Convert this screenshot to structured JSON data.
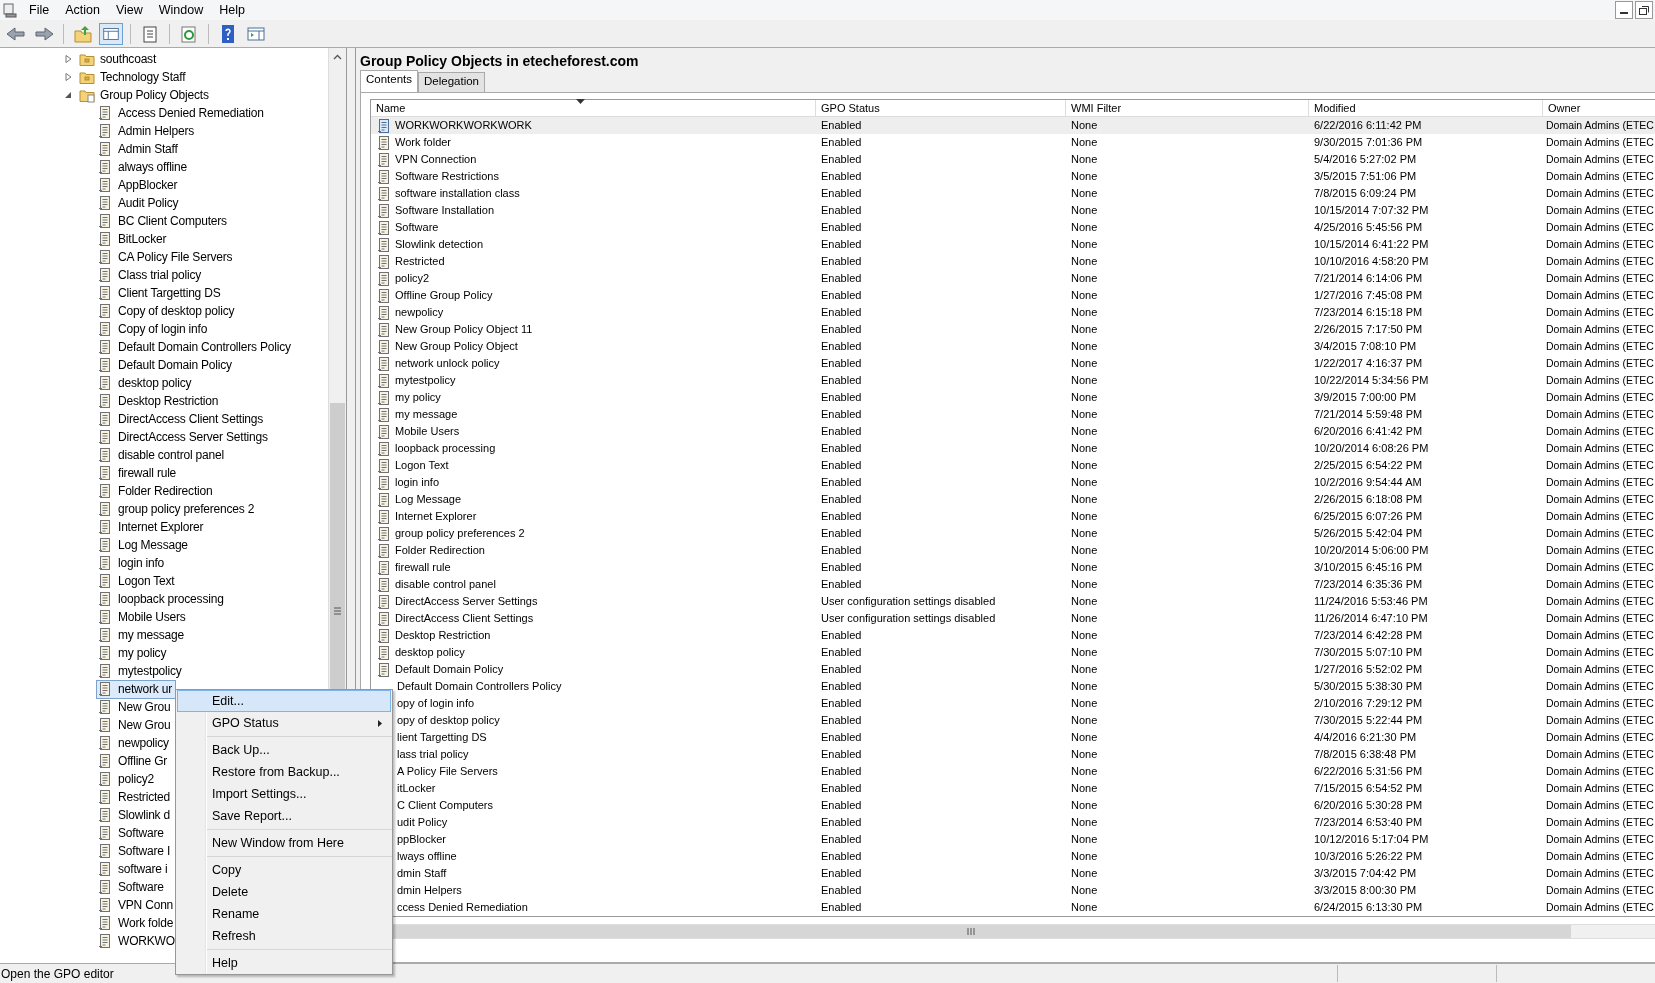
{
  "menu_bar": [
    "File",
    "Action",
    "View",
    "Window",
    "Help"
  ],
  "tree": {
    "items": [
      {
        "label": "southcoast",
        "kind": "folder",
        "expanded": false,
        "selected": false
      },
      {
        "label": "Technology Staff",
        "kind": "folder",
        "expanded": false,
        "selected": false
      },
      {
        "label": "Group Policy Objects",
        "kind": "gpo-folder",
        "expanded": true,
        "selected": false,
        "children": [
          {
            "label": "Access Denied Remediation",
            "selected": false
          },
          {
            "label": "Admin Helpers",
            "selected": false
          },
          {
            "label": "Admin Staff",
            "selected": false
          },
          {
            "label": "always offline",
            "selected": false
          },
          {
            "label": "AppBlocker",
            "selected": false
          },
          {
            "label": "Audit Policy",
            "selected": false
          },
          {
            "label": "BC Client Computers",
            "selected": false
          },
          {
            "label": "BitLocker",
            "selected": false
          },
          {
            "label": "CA Policy File Servers",
            "selected": false
          },
          {
            "label": "Class trial policy",
            "selected": false
          },
          {
            "label": "Client Targetting DS",
            "selected": false
          },
          {
            "label": "Copy of desktop policy",
            "selected": false
          },
          {
            "label": "Copy of login info",
            "selected": false
          },
          {
            "label": "Default Domain Controllers Policy",
            "selected": false
          },
          {
            "label": "Default Domain Policy",
            "selected": false
          },
          {
            "label": "desktop policy",
            "selected": false
          },
          {
            "label": "Desktop Restriction",
            "selected": false
          },
          {
            "label": "DirectAccess Client Settings",
            "selected": false
          },
          {
            "label": "DirectAccess Server Settings",
            "selected": false
          },
          {
            "label": "disable control panel",
            "selected": false
          },
          {
            "label": "firewall rule",
            "selected": false
          },
          {
            "label": "Folder Redirection",
            "selected": false
          },
          {
            "label": "group policy preferences 2",
            "selected": false
          },
          {
            "label": "Internet Explorer",
            "selected": false
          },
          {
            "label": "Log Message",
            "selected": false
          },
          {
            "label": "login info",
            "selected": false
          },
          {
            "label": "Logon Text",
            "selected": false
          },
          {
            "label": "loopback processing",
            "selected": false
          },
          {
            "label": "Mobile Users",
            "selected": false
          },
          {
            "label": "my message",
            "selected": false
          },
          {
            "label": "my policy",
            "selected": false
          },
          {
            "label": "mytestpolicy",
            "selected": false
          },
          {
            "label": "network ur",
            "selected": true
          },
          {
            "label": "New Grou",
            "selected": false
          },
          {
            "label": "New Grou",
            "selected": false
          },
          {
            "label": "newpolicy",
            "selected": false
          },
          {
            "label": "Offline Gr",
            "selected": false
          },
          {
            "label": "policy2",
            "selected": false
          },
          {
            "label": "Restricted",
            "selected": false
          },
          {
            "label": "Slowlink d",
            "selected": false
          },
          {
            "label": "Software",
            "selected": false
          },
          {
            "label": "Software I",
            "selected": false
          },
          {
            "label": "software i",
            "selected": false
          },
          {
            "label": "Software",
            "selected": false
          },
          {
            "label": "VPN Conn",
            "selected": false
          },
          {
            "label": "Work folde",
            "selected": false
          },
          {
            "label": "WORKWO",
            "selected": false
          }
        ]
      }
    ]
  },
  "panel": {
    "title": "Group Policy Objects in etecheforest.com",
    "tabs": [
      {
        "label": "Contents",
        "selected": true
      },
      {
        "label": "Delegation",
        "selected": false
      }
    ],
    "table": {
      "columns": [
        {
          "label": "Name",
          "sorted": true
        },
        {
          "label": "GPO Status",
          "sorted": false
        },
        {
          "label": "WMI Filter",
          "sorted": false
        },
        {
          "label": "Modified",
          "sorted": false
        },
        {
          "label": "Owner",
          "sorted": false
        }
      ],
      "rows": [
        {
          "name": "WORKWORKWORKWORK",
          "status": "Enabled",
          "wmi_filter": "None",
          "modified": "6/22/2016 6:11:42 PM",
          "owner": "Domain Admins (ETEC",
          "icon": true,
          "selected": true
        },
        {
          "name": "Work folder",
          "status": "Enabled",
          "wmi_filter": "None",
          "modified": "9/30/2015 7:01:36 PM",
          "owner": "Domain Admins (ETEC",
          "icon": true,
          "selected": false
        },
        {
          "name": "VPN Connection",
          "status": "Enabled",
          "wmi_filter": "None",
          "modified": "5/4/2016 5:27:02 PM",
          "owner": "Domain Admins (ETEC",
          "icon": true,
          "selected": false
        },
        {
          "name": "Software Restrictions",
          "status": "Enabled",
          "wmi_filter": "None",
          "modified": "3/5/2015 7:51:06 PM",
          "owner": "Domain Admins (ETEC",
          "icon": true,
          "selected": false
        },
        {
          "name": "software installation class",
          "status": "Enabled",
          "wmi_filter": "None",
          "modified": "7/8/2015 6:09:24 PM",
          "owner": "Domain Admins (ETEC",
          "icon": true,
          "selected": false
        },
        {
          "name": "Software Installation",
          "status": "Enabled",
          "wmi_filter": "None",
          "modified": "10/15/2014 7:07:32 PM",
          "owner": "Domain Admins (ETEC",
          "icon": true,
          "selected": false
        },
        {
          "name": "Software",
          "status": "Enabled",
          "wmi_filter": "None",
          "modified": "4/25/2016 5:45:56 PM",
          "owner": "Domain Admins (ETEC",
          "icon": true,
          "selected": false
        },
        {
          "name": "Slowlink detection",
          "status": "Enabled",
          "wmi_filter": "None",
          "modified": "10/15/2014 6:41:22 PM",
          "owner": "Domain Admins (ETEC",
          "icon": true,
          "selected": false
        },
        {
          "name": "Restricted",
          "status": "Enabled",
          "wmi_filter": "None",
          "modified": "10/10/2016 4:58:20 PM",
          "owner": "Domain Admins (ETEC",
          "icon": true,
          "selected": false
        },
        {
          "name": "policy2",
          "status": "Enabled",
          "wmi_filter": "None",
          "modified": "7/21/2014 6:14:06 PM",
          "owner": "Domain Admins (ETEC",
          "icon": true,
          "selected": false
        },
        {
          "name": "Offline Group Policy",
          "status": "Enabled",
          "wmi_filter": "None",
          "modified": "1/27/2016 7:45:08 PM",
          "owner": "Domain Admins (ETEC",
          "icon": true,
          "selected": false
        },
        {
          "name": "newpolicy",
          "status": "Enabled",
          "wmi_filter": "None",
          "modified": "7/23/2014 6:15:18 PM",
          "owner": "Domain Admins (ETEC",
          "icon": true,
          "selected": false
        },
        {
          "name": "New Group Policy Object 11",
          "status": "Enabled",
          "wmi_filter": "None",
          "modified": "2/26/2015 7:17:50 PM",
          "owner": "Domain Admins (ETEC",
          "icon": true,
          "selected": false
        },
        {
          "name": "New Group Policy Object",
          "status": "Enabled",
          "wmi_filter": "None",
          "modified": "3/4/2015 7:08:10 PM",
          "owner": "Domain Admins (ETEC",
          "icon": true,
          "selected": false
        },
        {
          "name": "network unlock policy",
          "status": "Enabled",
          "wmi_filter": "None",
          "modified": "1/22/2017 4:16:37 PM",
          "owner": "Domain Admins (ETEC",
          "icon": true,
          "selected": false
        },
        {
          "name": "mytestpolicy",
          "status": "Enabled",
          "wmi_filter": "None",
          "modified": "10/22/2014 5:34:56 PM",
          "owner": "Domain Admins (ETEC",
          "icon": true,
          "selected": false
        },
        {
          "name": "my policy",
          "status": "Enabled",
          "wmi_filter": "None",
          "modified": "3/9/2015 7:00:00 PM",
          "owner": "Domain Admins (ETEC",
          "icon": true,
          "selected": false
        },
        {
          "name": "my message",
          "status": "Enabled",
          "wmi_filter": "None",
          "modified": "7/21/2014 5:59:48 PM",
          "owner": "Domain Admins (ETEC",
          "icon": true,
          "selected": false
        },
        {
          "name": "Mobile Users",
          "status": "Enabled",
          "wmi_filter": "None",
          "modified": "6/20/2016 6:41:42 PM",
          "owner": "Domain Admins (ETEC",
          "icon": true,
          "selected": false
        },
        {
          "name": "loopback processing",
          "status": "Enabled",
          "wmi_filter": "None",
          "modified": "10/20/2014 6:08:26 PM",
          "owner": "Domain Admins (ETEC",
          "icon": true,
          "selected": false
        },
        {
          "name": "Logon Text",
          "status": "Enabled",
          "wmi_filter": "None",
          "modified": "2/25/2015 6:54:22 PM",
          "owner": "Domain Admins (ETEC",
          "icon": true,
          "selected": false
        },
        {
          "name": "login info",
          "status": "Enabled",
          "wmi_filter": "None",
          "modified": "10/2/2016 9:54:44 AM",
          "owner": "Domain Admins (ETEC",
          "icon": true,
          "selected": false
        },
        {
          "name": "Log Message",
          "status": "Enabled",
          "wmi_filter": "None",
          "modified": "2/26/2015 6:18:08 PM",
          "owner": "Domain Admins (ETEC",
          "icon": true,
          "selected": false
        },
        {
          "name": "Internet Explorer",
          "status": "Enabled",
          "wmi_filter": "None",
          "modified": "6/25/2015 6:07:26 PM",
          "owner": "Domain Admins (ETEC",
          "icon": true,
          "selected": false
        },
        {
          "name": "group policy preferences 2",
          "status": "Enabled",
          "wmi_filter": "None",
          "modified": "5/26/2015 5:42:04 PM",
          "owner": "Domain Admins (ETEC",
          "icon": true,
          "selected": false
        },
        {
          "name": "Folder Redirection",
          "status": "Enabled",
          "wmi_filter": "None",
          "modified": "10/20/2014 5:06:00 PM",
          "owner": "Domain Admins (ETEC",
          "icon": true,
          "selected": false
        },
        {
          "name": "firewall rule",
          "status": "Enabled",
          "wmi_filter": "None",
          "modified": "3/10/2015 6:45:16 PM",
          "owner": "Domain Admins (ETEC",
          "icon": true,
          "selected": false
        },
        {
          "name": "disable control panel",
          "status": "Enabled",
          "wmi_filter": "None",
          "modified": "7/23/2014 6:35:36 PM",
          "owner": "Domain Admins (ETEC",
          "icon": true,
          "selected": false
        },
        {
          "name": "DirectAccess Server Settings",
          "status": "User configuration settings disabled",
          "wmi_filter": "None",
          "modified": "11/24/2016 5:53:46 PM",
          "owner": "Domain Admins (ETEC",
          "icon": true,
          "selected": false
        },
        {
          "name": "DirectAccess Client Settings",
          "status": "User configuration settings disabled",
          "wmi_filter": "None",
          "modified": "11/26/2014 6:47:10 PM",
          "owner": "Domain Admins (ETEC",
          "icon": true,
          "selected": false
        },
        {
          "name": "Desktop Restriction",
          "status": "Enabled",
          "wmi_filter": "None",
          "modified": "7/23/2014 6:42:28 PM",
          "owner": "Domain Admins (ETEC",
          "icon": true,
          "selected": false
        },
        {
          "name": "desktop policy",
          "status": "Enabled",
          "wmi_filter": "None",
          "modified": "7/30/2015 5:07:10 PM",
          "owner": "Domain Admins (ETEC",
          "icon": true,
          "selected": false
        },
        {
          "name": "Default Domain Policy",
          "status": "Enabled",
          "wmi_filter": "None",
          "modified": "1/27/2016 5:52:02 PM",
          "owner": "Domain Admins (ETEC",
          "icon": true,
          "selected": false
        },
        {
          "name": "Default Domain Controllers Policy",
          "status": "Enabled",
          "wmi_filter": "None",
          "modified": "5/30/2015 5:38:30 PM",
          "owner": "Domain Admins (ETEC",
          "icon": false,
          "selected": false
        },
        {
          "name": "opy of login info",
          "status": "Enabled",
          "wmi_filter": "None",
          "modified": "2/10/2016 7:29:12 PM",
          "owner": "Domain Admins (ETEC",
          "icon": false,
          "selected": false
        },
        {
          "name": "opy of desktop policy",
          "status": "Enabled",
          "wmi_filter": "None",
          "modified": "7/30/2015 5:22:44 PM",
          "owner": "Domain Admins (ETEC",
          "icon": false,
          "selected": false
        },
        {
          "name": "lient Targetting DS",
          "status": "Enabled",
          "wmi_filter": "None",
          "modified": "4/4/2016 6:21:30 PM",
          "owner": "Domain Admins (ETEC",
          "icon": false,
          "selected": false
        },
        {
          "name": "lass trial policy",
          "status": "Enabled",
          "wmi_filter": "None",
          "modified": "7/8/2015 6:38:48 PM",
          "owner": "Domain Admins (ETEC",
          "icon": false,
          "selected": false
        },
        {
          "name": "A Policy File Servers",
          "status": "Enabled",
          "wmi_filter": "None",
          "modified": "6/22/2016 5:31:56 PM",
          "owner": "Domain Admins (ETEC",
          "icon": false,
          "selected": false
        },
        {
          "name": "itLocker",
          "status": "Enabled",
          "wmi_filter": "None",
          "modified": "7/15/2015 6:54:52 PM",
          "owner": "Domain Admins (ETEC",
          "icon": false,
          "selected": false
        },
        {
          "name": "C Client Computers",
          "status": "Enabled",
          "wmi_filter": "None",
          "modified": "6/20/2016 5:30:28 PM",
          "owner": "Domain Admins (ETEC",
          "icon": false,
          "selected": false
        },
        {
          "name": "udit Policy",
          "status": "Enabled",
          "wmi_filter": "None",
          "modified": "7/23/2014 6:53:40 PM",
          "owner": "Domain Admins (ETEC",
          "icon": false,
          "selected": false
        },
        {
          "name": "ppBlocker",
          "status": "Enabled",
          "wmi_filter": "None",
          "modified": "10/12/2016 5:17:04 PM",
          "owner": "Domain Admins (ETEC",
          "icon": false,
          "selected": false
        },
        {
          "name": "lways offline",
          "status": "Enabled",
          "wmi_filter": "None",
          "modified": "10/3/2016 5:26:22 PM",
          "owner": "Domain Admins (ETEC",
          "icon": false,
          "selected": false
        },
        {
          "name": "dmin Staff",
          "status": "Enabled",
          "wmi_filter": "None",
          "modified": "3/3/2015 7:04:42 PM",
          "owner": "Domain Admins (ETEC",
          "icon": false,
          "selected": false
        },
        {
          "name": "dmin Helpers",
          "status": "Enabled",
          "wmi_filter": "None",
          "modified": "3/3/2015 8:00:30 PM",
          "owner": "Domain Admins (ETEC",
          "icon": false,
          "selected": false
        },
        {
          "name": "ccess Denied Remediation",
          "status": "Enabled",
          "wmi_filter": "None",
          "modified": "6/24/2015 6:13:30 PM",
          "owner": "Domain Admins (ETEC",
          "icon": false,
          "selected": false
        }
      ]
    }
  },
  "context_menu": {
    "items": [
      {
        "kind": "item",
        "label": "Edit...",
        "selected": true,
        "submenu": false
      },
      {
        "kind": "item",
        "label": "GPO Status",
        "selected": false,
        "submenu": true
      },
      {
        "kind": "separator"
      },
      {
        "kind": "item",
        "label": "Back Up...",
        "selected": false,
        "submenu": false
      },
      {
        "kind": "item",
        "label": "Restore from Backup...",
        "selected": false,
        "submenu": false
      },
      {
        "kind": "item",
        "label": "Import Settings...",
        "selected": false,
        "submenu": false
      },
      {
        "kind": "item",
        "label": "Save Report...",
        "selected": false,
        "submenu": false
      },
      {
        "kind": "separator"
      },
      {
        "kind": "item",
        "label": "New Window from Here",
        "selected": false,
        "submenu": false
      },
      {
        "kind": "separator"
      },
      {
        "kind": "item",
        "label": "Copy",
        "selected": false,
        "submenu": false
      },
      {
        "kind": "item",
        "label": "Delete",
        "selected": false,
        "submenu": false
      },
      {
        "kind": "item",
        "label": "Rename",
        "selected": false,
        "submenu": false
      },
      {
        "kind": "item",
        "label": "Refresh",
        "selected": false,
        "submenu": false
      },
      {
        "kind": "separator"
      },
      {
        "kind": "item",
        "label": "Help",
        "selected": false,
        "submenu": false
      }
    ]
  },
  "status_bar": {
    "text": "Open the GPO editor"
  }
}
